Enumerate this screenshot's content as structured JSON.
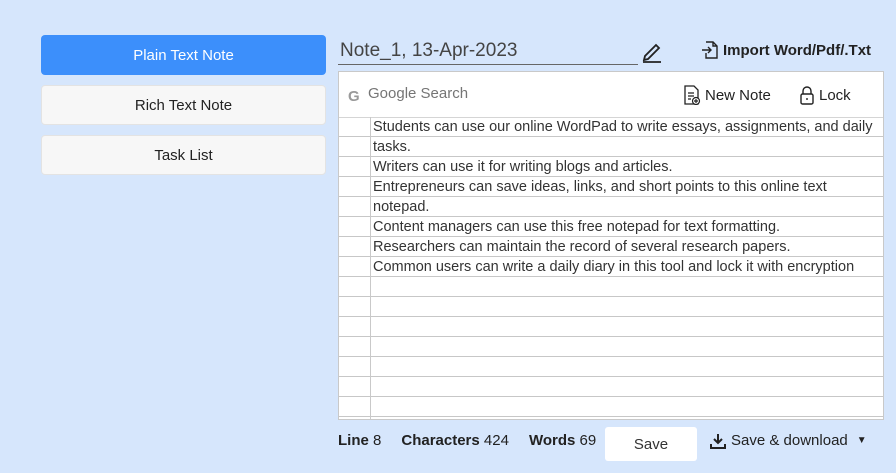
{
  "sidebar": {
    "items": [
      {
        "label": "Plain Text Note"
      },
      {
        "label": "Rich Text Note"
      },
      {
        "label": "Task List"
      }
    ]
  },
  "note": {
    "title": "Note_1, 13-Apr-2023",
    "import_label": "Import Word/Pdf/.Txt"
  },
  "toolbar": {
    "search_placeholder": "Google Search",
    "new_note_label": "New Note",
    "lock_label": "Lock"
  },
  "content": {
    "lines": [
      "Students can use our online WordPad to write essays, assignments, and daily tasks.",
      "Writers can use it for writing blogs and articles.",
      "Entrepreneurs can save ideas, links, and short points to this online text notepad.",
      "Content managers can use this free notepad for text formatting.",
      "Researchers can maintain the record of several research papers.",
      "Common users can write a daily diary in this tool and lock it with encryption"
    ]
  },
  "status": {
    "line_label": "Line",
    "line_value": "8",
    "chars_label": "Characters",
    "chars_value": "424",
    "words_label": "Words",
    "words_value": "69"
  },
  "actions": {
    "save_label": "Save",
    "download_label": "Save & download"
  },
  "colors": {
    "accent": "#3c8ffb",
    "background": "#d6e6fc"
  }
}
